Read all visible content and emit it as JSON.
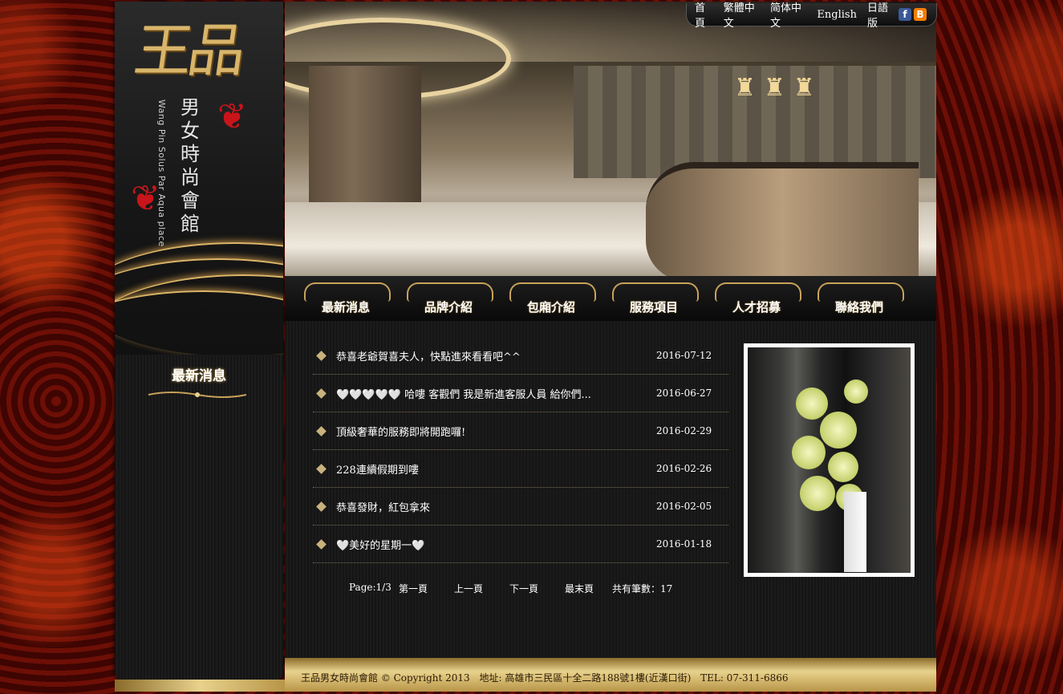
{
  "logo": {
    "main": "王品",
    "sub": "男女時尚會館",
    "en": "Wang Pin Solus Par Aqua place"
  },
  "lang_bar": {
    "items": [
      "首頁",
      "繁體中文",
      "简体中文",
      "English",
      "日語版"
    ],
    "icons": [
      "facebook-icon",
      "blogger-icon"
    ]
  },
  "nav": {
    "items": [
      "最新消息",
      "品牌介紹",
      "包廂介紹",
      "服務項目",
      "人才招募",
      "聯絡我們"
    ]
  },
  "sidebar": {
    "title": "最新消息"
  },
  "news": [
    {
      "title": "恭喜老爺賀喜夫人，快點進來看看吧^^",
      "date": "2016-07-12"
    },
    {
      "title": "🤍🤍🤍🤍🤍 哈嘍 客觀們 我是新進客服人員 給你們...",
      "date": "2016-06-27"
    },
    {
      "title": "頂級奢華的服務即將開跑囉!",
      "date": "2016-02-29"
    },
    {
      "title": "228連續假期到嘍",
      "date": "2016-02-26"
    },
    {
      "title": "恭喜發財，紅包拿來",
      "date": "2016-02-05"
    },
    {
      "title": "🤍美好的星期一🤍",
      "date": "2016-01-18"
    }
  ],
  "pager": {
    "page": "Page:1/3",
    "first": "第一頁",
    "prev": "上一頁",
    "next": "下一頁",
    "last": "最末頁",
    "total": "共有筆數：17"
  },
  "footer": {
    "copyright": "王品男女時尚會館 © Copyright 2013",
    "address": "地址: 高雄市三民區十全二路188號1樓(近漢口街)",
    "tel": "TEL: 07-311-6866"
  },
  "colors": {
    "gold": "#c9a25a",
    "background_red": "#4a0804",
    "dark": "#151515"
  }
}
